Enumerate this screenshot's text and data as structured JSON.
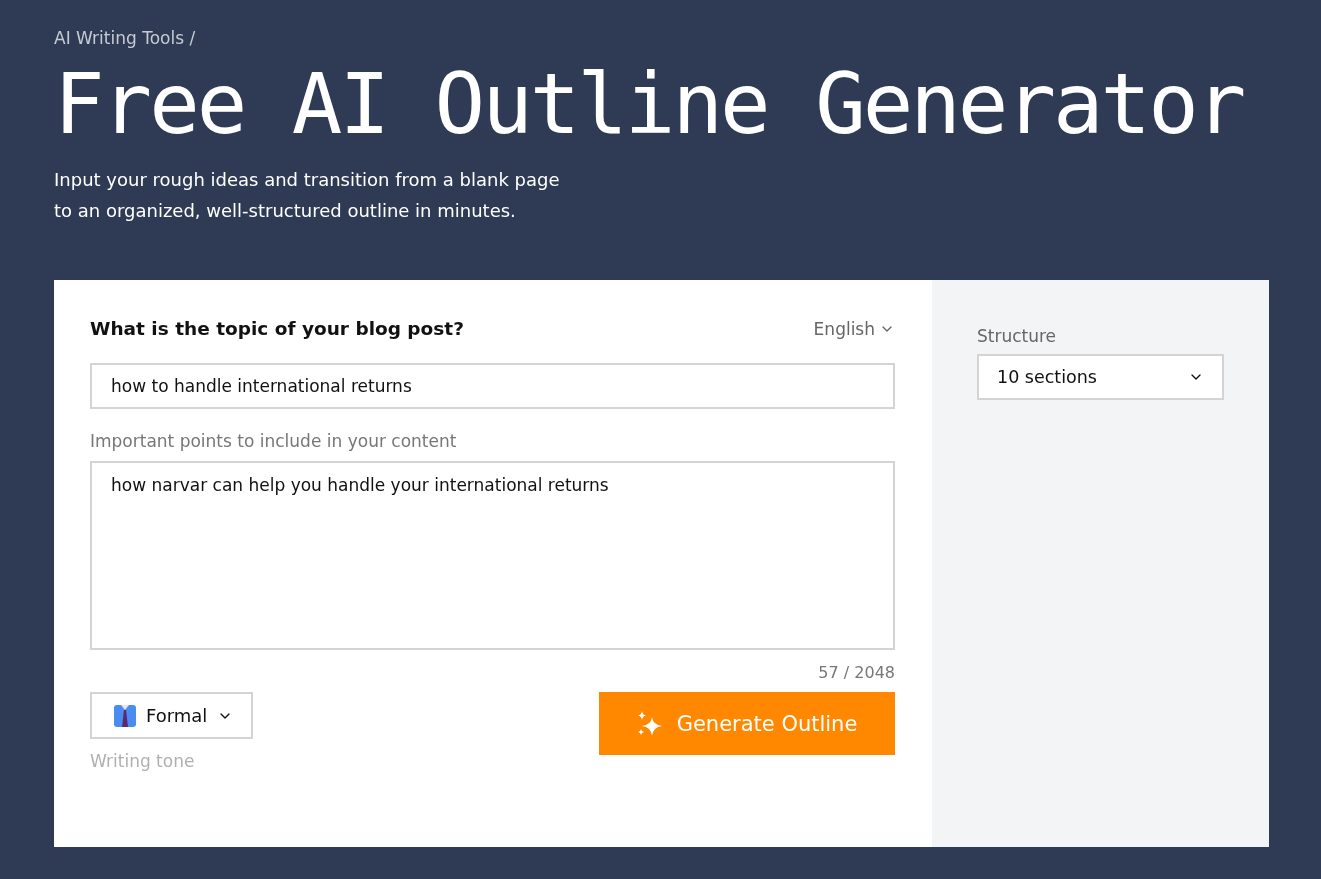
{
  "breadcrumb": "AI Writing Tools /",
  "title": "Free AI Outline Generator",
  "subtitle_lines": [
    "Input your rough ideas and transition from a blank page",
    "to an organized, well-structured outline in minutes."
  ],
  "form": {
    "topic_label": "What is the topic of your blog post?",
    "language": "English",
    "topic_value": "how to handle international returns",
    "points_label": "Important points to include in your content",
    "points_value": "how narvar can help you handle your international returns",
    "counter": "57 / 2048",
    "tone": "Formal",
    "tone_caption": "Writing tone",
    "submit": "Generate Outline"
  },
  "sidebar": {
    "structure_label": "Structure",
    "structure_value": "10 sections"
  }
}
